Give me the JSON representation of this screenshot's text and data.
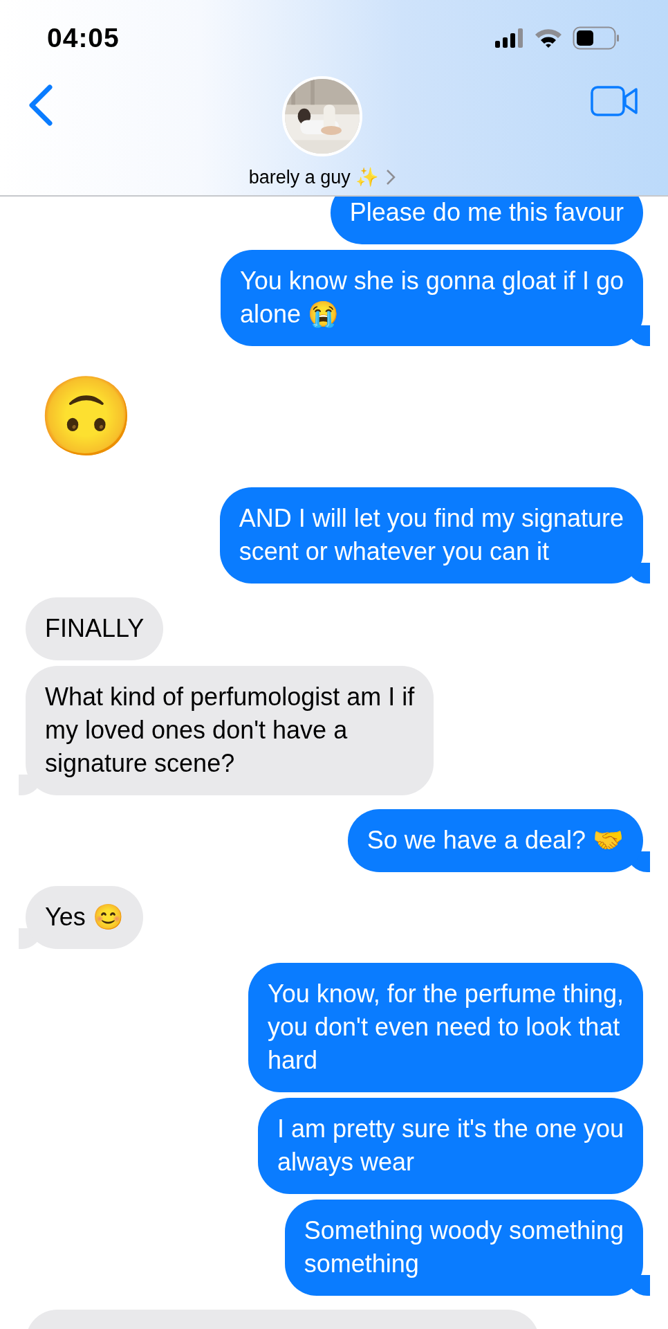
{
  "status_bar": {
    "time": "04:05"
  },
  "header": {
    "contact_name": "barely a guy ✨"
  },
  "messages": [
    {
      "kind": "sent",
      "text": "Please do me this favour"
    },
    {
      "kind": "sent",
      "text": "You know she is gonna gloat if I go\nalone 😭"
    },
    {
      "kind": "emoji",
      "text": "🙃"
    },
    {
      "kind": "sent",
      "text": "AND I will let you find my signature\nscent or whatever you can it"
    },
    {
      "kind": "received",
      "text": "FINALLY"
    },
    {
      "kind": "received",
      "text": "What kind of perfumologist am I if\nmy loved ones don't have a\nsignature scene?"
    },
    {
      "kind": "sent",
      "text": "So we have a deal? 🤝"
    },
    {
      "kind": "received",
      "text": "Yes 😊"
    },
    {
      "kind": "sent",
      "text": "You know, for the perfume thing,\nyou don't even need to look that\nhard"
    },
    {
      "kind": "sent",
      "text": "I am pretty sure it's the one you\nalways wear"
    },
    {
      "kind": "sent",
      "text": "Something woody something\nsomething"
    },
    {
      "kind": "received_cut_off"
    }
  ]
}
